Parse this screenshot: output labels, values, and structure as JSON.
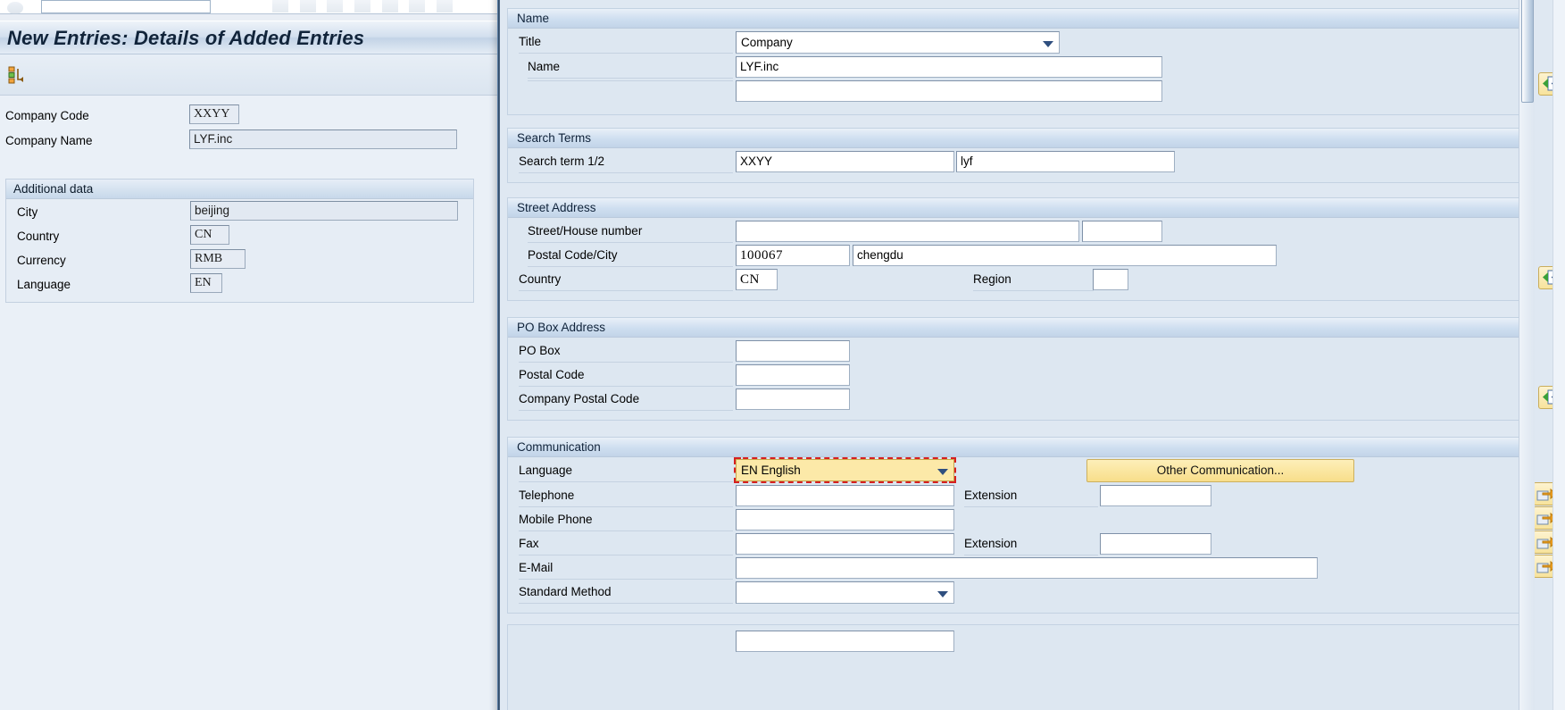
{
  "window": {
    "page_title": "New Entries: Details of Added Entries"
  },
  "left_form": {
    "rows": [
      {
        "label": "Company Code",
        "value": "XXYY"
      },
      {
        "label": "Company Name",
        "value": "LYF.inc"
      }
    ],
    "additional_data": {
      "header": "Additional data",
      "rows": [
        {
          "label": "City",
          "value": "beijing"
        },
        {
          "label": "Country",
          "value": "CN"
        },
        {
          "label": "Currency",
          "value": "RMB"
        },
        {
          "label": "Language",
          "value": "EN"
        }
      ]
    }
  },
  "dialog": {
    "name_section": {
      "header": "Name",
      "title_label": "Title",
      "title_value": "Company",
      "name_label": "Name",
      "name_value": "LYF.inc",
      "name_value_2": ""
    },
    "search_terms_section": {
      "header": "Search Terms",
      "label": "Search term 1/2",
      "term1": "XXYY",
      "term2": "lyf"
    },
    "street_address_section": {
      "header": "Street Address",
      "street_label": "Street/House number",
      "street_value": "",
      "house_value": "",
      "postal_city_label": "Postal Code/City",
      "postal_value": "100067",
      "city_value": "chengdu",
      "country_label": "Country",
      "country_value": "CN",
      "region_label": "Region",
      "region_value": ""
    },
    "po_box_section": {
      "header": "PO Box Address",
      "po_box_label": "PO Box",
      "po_box_value": "",
      "postal_code_label": "Postal Code",
      "postal_code_value": "",
      "company_postal_label": "Company Postal Code",
      "company_postal_value": ""
    },
    "communication_section": {
      "header": "Communication",
      "language_label": "Language",
      "language_value": "EN English",
      "other_comm_button": "Other Communication...",
      "telephone_label": "Telephone",
      "telephone_value": "",
      "telephone_ext_label": "Extension",
      "telephone_ext_value": "",
      "mobile_label": "Mobile Phone",
      "mobile_value": "",
      "fax_label": "Fax",
      "fax_value": "",
      "fax_ext_label": "Extension",
      "fax_ext_value": "",
      "email_label": "E-Mail",
      "email_value": "",
      "standard_method_label": "Standard Method",
      "standard_method_value": ""
    }
  },
  "colors": {
    "accent_yellow": "#f8de8a",
    "focus_red": "#d62020",
    "header_blue": "#c2d4e8",
    "panel_bg": "#dde7f1"
  }
}
